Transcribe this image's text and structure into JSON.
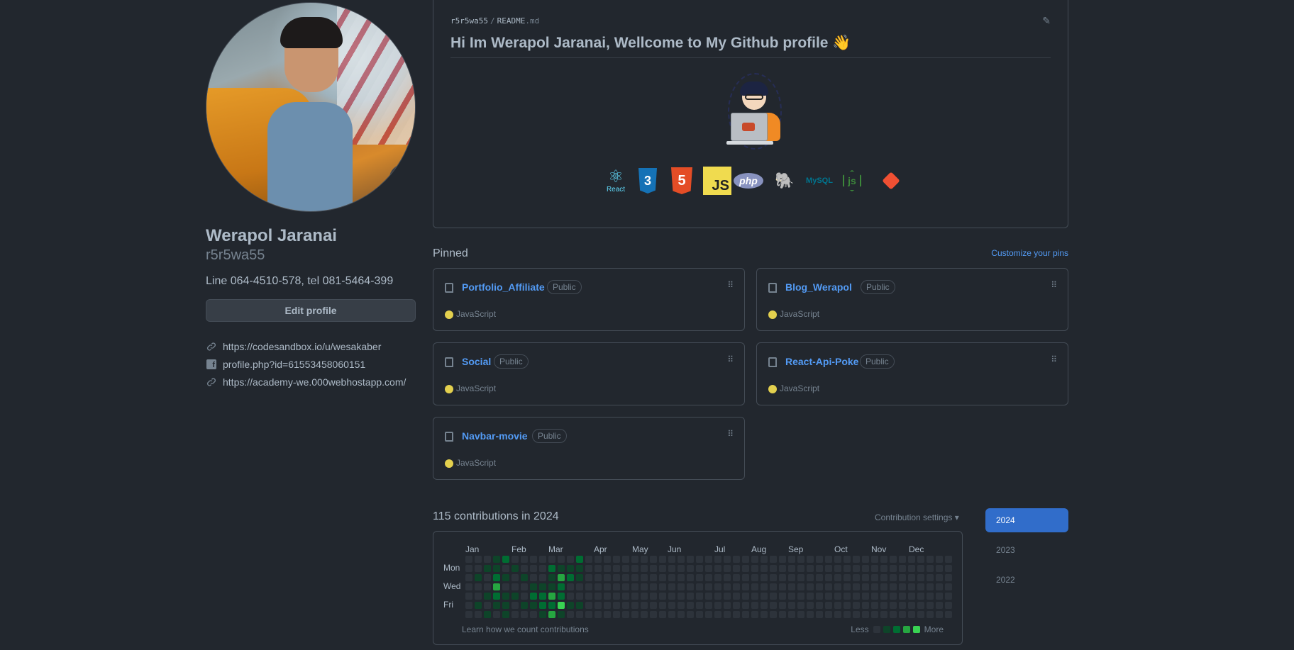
{
  "profile": {
    "name": "Werapol Jaranai",
    "login": "r5r5wa55",
    "bio": "Line 064-4510-578, tel 081-5464-399",
    "edit_label": "Edit profile",
    "links": [
      {
        "icon": "link-icon",
        "text": "https://codesandbox.io/u/wesakaber"
      },
      {
        "icon": "facebook-icon",
        "text": "profile.php?id=61553458060151"
      },
      {
        "icon": "link-icon",
        "text": "https://academy-we.000webhostapp.com/"
      }
    ]
  },
  "readme": {
    "owner": "r5r5wa55",
    "sep": "/",
    "file": "README",
    "ext": ".md",
    "title": "Hi Im Werapol Jaranai, Wellcome to My Github profile 👋",
    "tech_icons": [
      "react",
      "css3",
      "html5",
      "javascript",
      "php",
      "postgresql",
      "mysql",
      "nodejs",
      "git"
    ],
    "react_label": "React",
    "css_glyph": "3",
    "html_glyph": "5",
    "js_glyph": "JS",
    "php_glyph": "php",
    "mysql_glyph": "MySQL"
  },
  "pinned": {
    "heading": "Pinned",
    "customize_label": "Customize your pins",
    "repos": [
      {
        "name": "Portfolio_Affiliate",
        "visibility": "Public",
        "language": "JavaScript",
        "lang_color": "#e3d04e"
      },
      {
        "name": "Blog_Werapol",
        "visibility": "Public",
        "language": "JavaScript",
        "lang_color": "#e3d04e"
      },
      {
        "name": "Social",
        "visibility": "Public",
        "language": "JavaScript",
        "lang_color": "#e3d04e"
      },
      {
        "name": "React-Api-Poke",
        "visibility": "Public",
        "language": "JavaScript",
        "lang_color": "#e3d04e"
      },
      {
        "name": "Navbar-movie",
        "visibility": "Public",
        "language": "JavaScript",
        "lang_color": "#e3d04e"
      }
    ]
  },
  "contributions": {
    "heading": "115 contributions in 2024",
    "settings_label": "Contribution settings ▾",
    "years": [
      "2024",
      "2023",
      "2022"
    ],
    "selected_year": "2024",
    "months": [
      "Jan",
      "Feb",
      "Mar",
      "Apr",
      "May",
      "Jun",
      "Jul",
      "Aug",
      "Sep",
      "Oct",
      "Nov",
      "Dec"
    ],
    "days": [
      "Mon",
      "Wed",
      "Fri"
    ],
    "learn_label": "Learn how we count contributions",
    "legend_less": "Less",
    "legend_more": "More",
    "level_colors": [
      "#2d333b",
      "#0e4429",
      "#006d32",
      "#26a641",
      "#39d353"
    ],
    "active_days": [
      {
        "week": 1,
        "day": 2,
        "level": 1
      },
      {
        "week": 1,
        "day": 5,
        "level": 1
      },
      {
        "week": 2,
        "day": 1,
        "level": 1
      },
      {
        "week": 2,
        "day": 4,
        "level": 1
      },
      {
        "week": 2,
        "day": 6,
        "level": 1
      },
      {
        "week": 3,
        "day": 0,
        "level": 1
      },
      {
        "week": 3,
        "day": 1,
        "level": 1
      },
      {
        "week": 3,
        "day": 2,
        "level": 2
      },
      {
        "week": 3,
        "day": 3,
        "level": 3
      },
      {
        "week": 3,
        "day": 4,
        "level": 2
      },
      {
        "week": 3,
        "day": 5,
        "level": 1
      },
      {
        "week": 4,
        "day": 0,
        "level": 2
      },
      {
        "week": 4,
        "day": 2,
        "level": 1
      },
      {
        "week": 4,
        "day": 4,
        "level": 1
      },
      {
        "week": 4,
        "day": 5,
        "level": 1
      },
      {
        "week": 4,
        "day": 6,
        "level": 1
      },
      {
        "week": 5,
        "day": 1,
        "level": 1
      },
      {
        "week": 5,
        "day": 4,
        "level": 1
      },
      {
        "week": 6,
        "day": 2,
        "level": 1
      },
      {
        "week": 6,
        "day": 5,
        "level": 1
      },
      {
        "week": 7,
        "day": 3,
        "level": 1
      },
      {
        "week": 7,
        "day": 4,
        "level": 2
      },
      {
        "week": 7,
        "day": 5,
        "level": 1
      },
      {
        "week": 8,
        "day": 3,
        "level": 1
      },
      {
        "week": 8,
        "day": 4,
        "level": 2
      },
      {
        "week": 8,
        "day": 5,
        "level": 2
      },
      {
        "week": 8,
        "day": 6,
        "level": 1
      },
      {
        "week": 9,
        "day": 1,
        "level": 2
      },
      {
        "week": 9,
        "day": 2,
        "level": 1
      },
      {
        "week": 9,
        "day": 3,
        "level": 1
      },
      {
        "week": 9,
        "day": 4,
        "level": 3
      },
      {
        "week": 9,
        "day": 5,
        "level": 2
      },
      {
        "week": 9,
        "day": 6,
        "level": 3
      },
      {
        "week": 10,
        "day": 1,
        "level": 1
      },
      {
        "week": 10,
        "day": 2,
        "level": 3
      },
      {
        "week": 10,
        "day": 3,
        "level": 2
      },
      {
        "week": 10,
        "day": 4,
        "level": 2
      },
      {
        "week": 10,
        "day": 5,
        "level": 4
      },
      {
        "week": 10,
        "day": 6,
        "level": 1
      },
      {
        "week": 11,
        "day": 1,
        "level": 1
      },
      {
        "week": 11,
        "day": 2,
        "level": 2
      },
      {
        "week": 11,
        "day": 5,
        "level": 1
      },
      {
        "week": 12,
        "day": 0,
        "level": 2
      },
      {
        "week": 12,
        "day": 1,
        "level": 1
      },
      {
        "week": 12,
        "day": 2,
        "level": 1
      },
      {
        "week": 12,
        "day": 5,
        "level": 1
      }
    ]
  }
}
